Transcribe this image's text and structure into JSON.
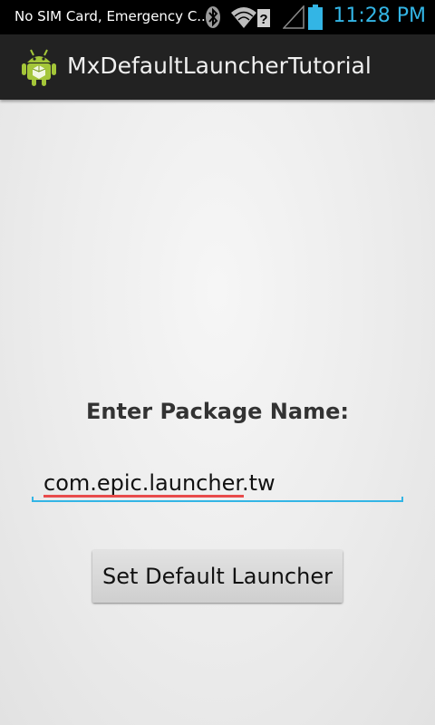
{
  "status_bar": {
    "carrier_text": "No SIM Card, Emergency C...",
    "time": "11:28 PM",
    "icons": [
      "bluetooth-icon",
      "wifi-icon",
      "signal-icon",
      "battery-icon"
    ],
    "accent_color": "#33b5e5"
  },
  "action_bar": {
    "app_icon": "android-app-icon",
    "title": "MxDefaultLauncherTutorial"
  },
  "content": {
    "prompt_label": "Enter Package Name:",
    "package_input_value": "com.epic.launcher.tw",
    "button_label": "Set Default Launcher"
  }
}
